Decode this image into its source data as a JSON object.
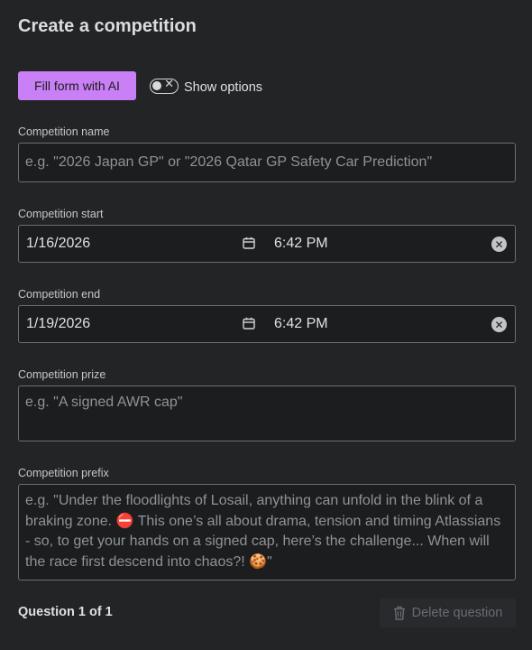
{
  "page": {
    "title": "Create a competition"
  },
  "toolbar": {
    "ai_button_label": "Fill form with AI",
    "toggle_label": "Show options",
    "toggle_on": false
  },
  "fields": {
    "name": {
      "label": "Competition name",
      "placeholder": "e.g. \"2026 Japan GP\" or \"2026 Qatar GP Safety Car Prediction\"",
      "value": ""
    },
    "start": {
      "label": "Competition start",
      "date": "1/16/2026",
      "time": "6:42 PM"
    },
    "end": {
      "label": "Competition end",
      "date": "1/19/2026",
      "time": "6:42 PM"
    },
    "prize": {
      "label": "Competition prize",
      "placeholder": "e.g. \"A signed AWR cap\"",
      "value": ""
    },
    "prefix": {
      "label": "Competition prefix",
      "placeholder": "e.g. \"Under the floodlights of Losail, anything can unfold in the blink of a braking zone. ⛔ This one’s all about drama, tension and timing Atlassians - so, to get your hands on a signed cap, here’s the challenge... When will the race first descend into chaos?! 🍪\"",
      "value": ""
    }
  },
  "question": {
    "counter": "Question 1 of 1",
    "delete_label": "Delete question"
  },
  "colors": {
    "accent": "#c97ff5",
    "background": "#232426",
    "field_background": "#1c1d1f",
    "field_border": "#6c6e72"
  }
}
